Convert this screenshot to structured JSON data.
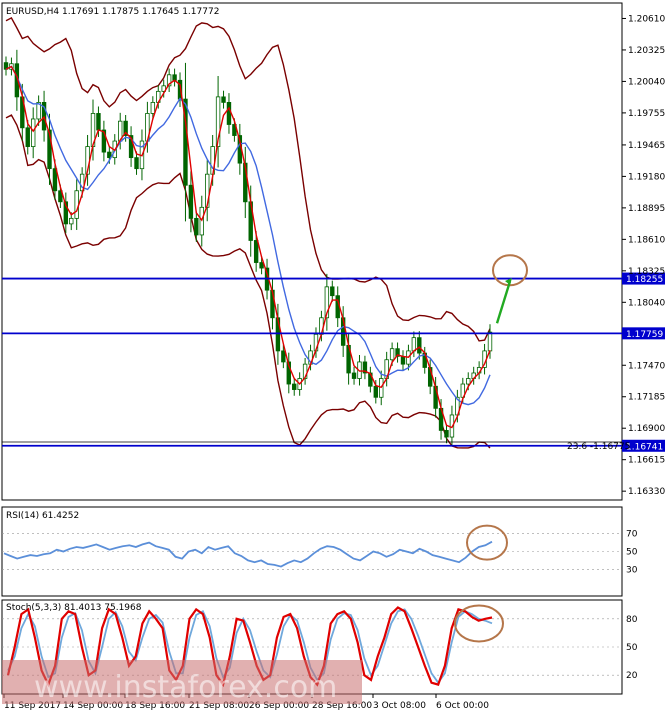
{
  "header": {
    "main": "EURUSD,H4  1.17691  1.17875  1.17645  1.17772",
    "rsi": "RSI(14) 61.4252",
    "stoch": "Stoch(5,3,3) 81.4013 75.1968"
  },
  "watermark": "www.instaforex.com",
  "fib_label": "23.6 -1.16775",
  "colors": {
    "candle": "#006400",
    "bollinger": "#7a0000",
    "ma_fast": "#e00000",
    "ma_slow": "#4169e1",
    "level": "#0000cd",
    "circle": "#b5764a",
    "arrow": "#22aa22",
    "rsi": "#5b8fd9",
    "stoch_main": "#e00000",
    "stoch_signal": "#6fa8dc",
    "watermark_band": "#c87070"
  },
  "chart_data": {
    "type": "line",
    "symbol": "EURUSD",
    "timeframe": "H4",
    "ohlc_current": {
      "open": 1.17691,
      "high": 1.17875,
      "low": 1.17645,
      "close": 1.17772
    },
    "x_tick_labels": [
      "11 Sep 2017",
      "14 Sep 00:00",
      "18 Sep 16:00",
      "21 Sep 08:00",
      "26 Sep 00:00",
      "28 Sep 16:00",
      "3 Oct 08:00",
      "6 Oct 00:00"
    ],
    "price_axis": {
      "ylim": [
        1.1625,
        1.2075
      ],
      "ticks": [
        1.2061,
        1.20325,
        1.2004,
        1.19755,
        1.19465,
        1.1918,
        1.18895,
        1.1861,
        1.18325,
        1.1804,
        1.1747,
        1.17185,
        1.169,
        1.16615,
        1.1633
      ]
    },
    "levels": [
      {
        "label": "1.18255",
        "value": 1.18255
      },
      {
        "label": "1.17759",
        "value": 1.17759
      },
      {
        "label": "1.16741",
        "value": 1.16741
      }
    ],
    "fib_level": {
      "text": "23.6 -1.16775",
      "value": 1.16775
    },
    "close_series": [
      1.2015,
      1.202,
      1.199,
      1.1962,
      1.1945,
      1.197,
      1.1985,
      1.196,
      1.1925,
      1.1905,
      1.1895,
      1.1875,
      1.188,
      1.1905,
      1.192,
      1.1945,
      1.1975,
      1.196,
      1.194,
      1.1935,
      1.195,
      1.1968,
      1.1955,
      1.1935,
      1.1925,
      1.195,
      1.1975,
      1.1985,
      1.1995,
      1.2,
      1.201,
      1.2005,
      1.1988,
      1.191,
      1.188,
      1.1865,
      1.189,
      1.192,
      1.1945,
      1.199,
      1.1985,
      1.1965,
      1.1955,
      1.193,
      1.1895,
      1.186,
      1.184,
      1.1835,
      1.1815,
      1.179,
      1.176,
      1.175,
      1.173,
      1.1725,
      1.1735,
      1.1748,
      1.176,
      1.1775,
      1.179,
      1.1818,
      1.181,
      1.179,
      1.1765,
      1.174,
      1.1735,
      1.175,
      1.174,
      1.1728,
      1.1718,
      1.1735,
      1.1752,
      1.1762,
      1.1755,
      1.1748,
      1.176,
      1.1772,
      1.1758,
      1.1745,
      1.1728,
      1.1708,
      1.1688,
      1.1682,
      1.1702,
      1.1718,
      1.173,
      1.1735,
      1.174,
      1.1745,
      1.176,
      1.1777
    ],
    "rsi": {
      "ylim": [
        0,
        100
      ],
      "ticks": [
        70,
        50,
        30
      ],
      "value": 61.4252,
      "values": [
        48,
        45,
        42,
        44,
        46,
        45,
        47,
        48,
        52,
        50,
        53,
        55,
        54,
        56,
        58,
        55,
        52,
        54,
        56,
        57,
        55,
        58,
        60,
        56,
        54,
        52,
        44,
        42,
        50,
        52,
        48,
        55,
        52,
        54,
        56,
        48,
        45,
        40,
        38,
        40,
        36,
        35,
        33,
        37,
        40,
        38,
        42,
        48,
        53,
        56,
        55,
        52,
        47,
        42,
        40,
        45,
        50,
        48,
        44,
        47,
        52,
        50,
        48,
        53,
        50,
        46,
        44,
        42,
        40,
        38,
        43,
        50,
        55,
        57,
        61
      ]
    },
    "stochastic": {
      "ylim": [
        0,
        100
      ],
      "ticks": [
        80,
        50,
        20
      ],
      "main": 81.4013,
      "signal": 75.1968,
      "main_values": [
        20,
        50,
        85,
        90,
        60,
        25,
        10,
        30,
        80,
        88,
        85,
        50,
        20,
        25,
        70,
        90,
        85,
        60,
        30,
        40,
        75,
        88,
        80,
        70,
        25,
        15,
        30,
        80,
        90,
        85,
        60,
        20,
        10,
        40,
        80,
        78,
        55,
        30,
        15,
        20,
        60,
        82,
        85,
        70,
        40,
        18,
        10,
        30,
        75,
        85,
        88,
        80,
        55,
        20,
        15,
        40,
        60,
        85,
        92,
        88,
        70,
        50,
        30,
        12,
        10,
        30,
        70,
        90,
        88,
        82,
        78,
        80,
        81.4
      ],
      "signal_values": [
        25,
        40,
        70,
        85,
        72,
        40,
        18,
        22,
        60,
        82,
        86,
        68,
        35,
        22,
        50,
        80,
        87,
        72,
        45,
        36,
        60,
        80,
        84,
        76,
        45,
        22,
        22,
        60,
        84,
        88,
        72,
        38,
        18,
        28,
        65,
        80,
        68,
        45,
        25,
        18,
        42,
        72,
        84,
        78,
        55,
        28,
        15,
        22,
        58,
        80,
        86,
        84,
        68,
        38,
        20,
        30,
        52,
        75,
        88,
        90,
        80,
        62,
        42,
        22,
        12,
        22,
        55,
        82,
        88,
        85,
        80,
        78,
        75.2
      ]
    }
  }
}
